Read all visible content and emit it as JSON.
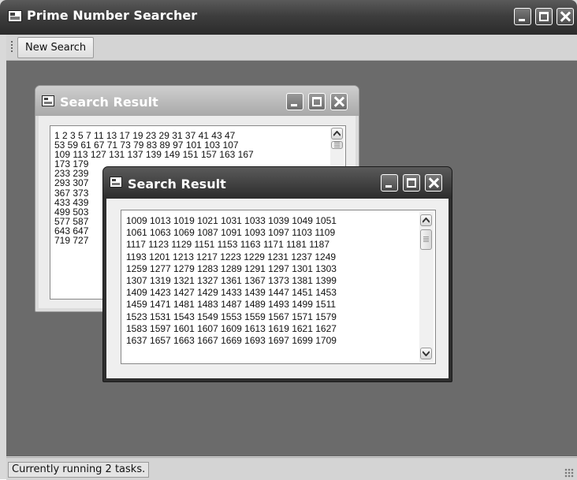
{
  "app": {
    "title": "Prime Number Searcher",
    "toolbar": {
      "new_search_label": "New Search"
    },
    "status_text": "Currently running 2 tasks."
  },
  "windows": [
    {
      "title": "Search Result",
      "state": "inactive",
      "rows": [
        "1 2 3 5 7 11 13 17 19 23 29 31 37 41 43 47",
        "53 59 61 67 71 73 79 83 89 97 101 103 107",
        "109 113 127 131 137 139 149 151 157 163 167",
        "173 179",
        "233 239",
        "293 307",
        "367 373",
        "433 439",
        "499 503",
        "577 587",
        "643 647",
        "719 727"
      ]
    },
    {
      "title": "Search Result",
      "state": "active",
      "rows": [
        "1009 1013 1019 1021 1031 1033 1039 1049 1051",
        "1061 1063 1069 1087 1091 1093 1097 1103 1109",
        "1117 1123 1129 1151 1153 1163 1171 1181 1187",
        "1193 1201 1213 1217 1223 1229 1231 1237 1249",
        "1259 1277 1279 1283 1289 1291 1297 1301 1303",
        "1307 1319 1321 1327 1361 1367 1373 1381 1399",
        "1409 1423 1427 1429 1433 1439 1447 1451 1453",
        "1459 1471 1481 1483 1487 1489 1493 1499 1511",
        "1523 1531 1543 1549 1553 1559 1567 1571 1579",
        "1583 1597 1601 1607 1609 1613 1619 1621 1627",
        "1637 1657 1663 1667 1669 1693 1697 1699 1709"
      ]
    }
  ]
}
